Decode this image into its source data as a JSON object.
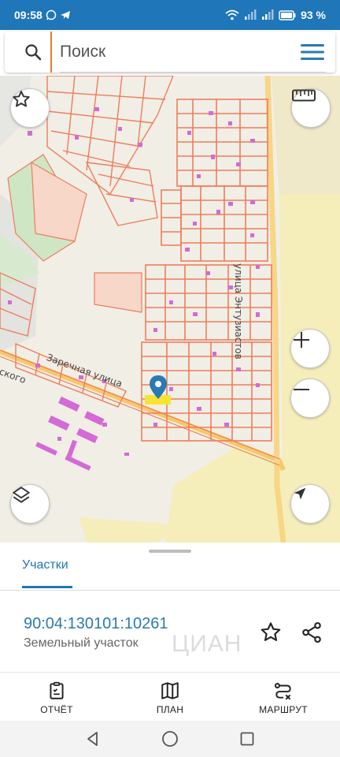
{
  "status_bar": {
    "time": "09:58",
    "battery": "93 %"
  },
  "search": {
    "placeholder": "Поиск"
  },
  "map": {
    "street_east": "улица Энтузиастов",
    "street_south": "Заречная улица",
    "street_partial": "ского",
    "colors": {
      "parcel_stroke": "#ee7d5c",
      "parcel_fill": "#f6d7c8",
      "road": "#f7c86a",
      "building": "#d36ad6",
      "marker": "#2a7ab4",
      "highlight": "#f5e432"
    }
  },
  "sheet": {
    "tab_label": "Участки",
    "cadastral_number": "90:04:130101:10261",
    "parcel_type": "Земельный участок",
    "watermark": "ЦИАН"
  },
  "actions": [
    {
      "label": "ОТЧЁТ",
      "icon": "report-icon"
    },
    {
      "label": "ПЛАН",
      "icon": "map-plan-icon"
    },
    {
      "label": "МАРШРУТ",
      "icon": "route-icon"
    }
  ]
}
